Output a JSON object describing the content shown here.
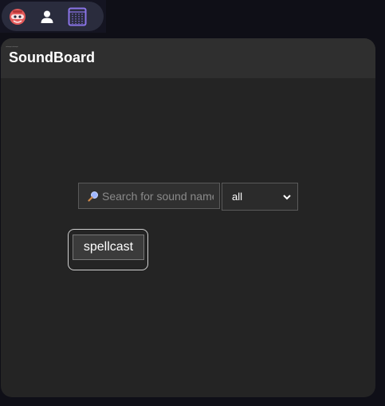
{
  "toolbar": {
    "icons": [
      "ninja-icon",
      "user-icon",
      "soundboard-icon"
    ],
    "accent": "#8a74e8"
  },
  "panel": {
    "title": "SoundBoard"
  },
  "search": {
    "placeholder": "Search for sound name",
    "value": ""
  },
  "filter": {
    "selected": "all"
  },
  "sounds": [
    {
      "label": "spellcast"
    }
  ]
}
